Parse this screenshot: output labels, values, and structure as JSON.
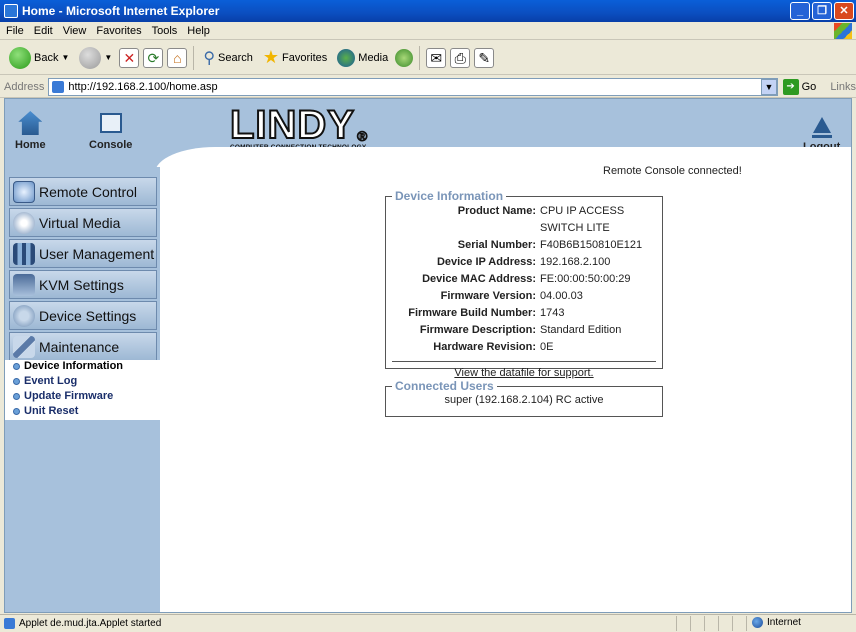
{
  "window": {
    "title": "Home - Microsoft Internet Explorer"
  },
  "menubar": [
    "File",
    "Edit",
    "View",
    "Favorites",
    "Tools",
    "Help"
  ],
  "toolbar": {
    "back": "Back",
    "search": "Search",
    "favorites": "Favorites",
    "media": "Media"
  },
  "address": {
    "label": "Address",
    "url": "http://192.168.2.100/home.asp",
    "go": "Go",
    "links": "Links"
  },
  "header": {
    "home": "Home",
    "console": "Console",
    "logout": "Logout",
    "logo_text": "LINDY",
    "logo_tagline": "COMPUTER CONNECTION TECHNOLOGY",
    "status_message": "Remote Console connected!"
  },
  "sidebar": {
    "items": [
      "Remote Control",
      "Virtual Media",
      "User Management",
      "KVM Settings",
      "Device Settings",
      "Maintenance"
    ],
    "sub_items": [
      "Device Information",
      "Event Log",
      "Update Firmware",
      "Unit Reset"
    ]
  },
  "device_info": {
    "legend": "Device Information",
    "rows": [
      {
        "key": "Product Name:",
        "value": "CPU IP ACCESS SWITCH LITE"
      },
      {
        "key": "Serial Number:",
        "value": "F40B6B150810E121"
      },
      {
        "key": "Device IP Address:",
        "value": "192.168.2.100"
      },
      {
        "key": "Device MAC Address:",
        "value": "FE:00:00:50:00:29"
      },
      {
        "key": "Firmware Version:",
        "value": "04.00.03"
      },
      {
        "key": "Firmware Build Number:",
        "value": "1743"
      },
      {
        "key": "Firmware Description:",
        "value": "Standard Edition"
      },
      {
        "key": "Hardware Revision:",
        "value": "0E"
      }
    ],
    "datafile_link": "View the datafile for support."
  },
  "connected_users": {
    "legend": "Connected Users",
    "entry": "super (192.168.2.104) RC active"
  },
  "statusbar": {
    "message": "Applet de.mud.jta.Applet started",
    "zone": "Internet"
  }
}
